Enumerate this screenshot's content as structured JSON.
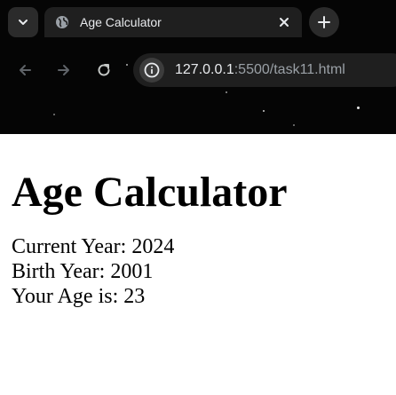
{
  "browser": {
    "tab_title": "Age Calculator",
    "url_host": "127.0.0.1",
    "url_path": ":5500/task11.html"
  },
  "page": {
    "heading": "Age Calculator",
    "current_year": "Current Year: 2024",
    "birth_year": "Birth Year: 2001",
    "age": "Your Age is: 23"
  },
  "icons": {
    "tab_menu": "chevron-down-icon",
    "tab_favicon": "globe-icon",
    "tab_close": "close-icon",
    "new_tab": "plus-icon",
    "back": "arrow-left-icon",
    "forward": "arrow-right-icon",
    "reload": "reload-icon",
    "site_info": "info-icon"
  },
  "colors": {
    "chrome_background": "#050505",
    "tab_background": "#1f1f1f",
    "page_background": "#ffffff"
  }
}
